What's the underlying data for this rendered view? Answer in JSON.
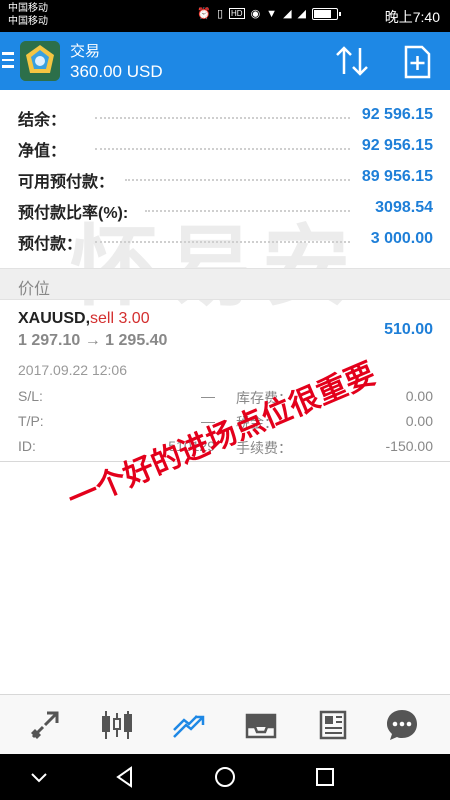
{
  "status_bar": {
    "carrier1": "中国移动",
    "carrier2": "中国移动",
    "icons": [
      "alarm-icon",
      "vibrate-icon",
      "hd-icon",
      "eye-icon",
      "wifi-icon",
      "signal-4g-icon",
      "signal-2g-icon"
    ],
    "time": "晚上7:40"
  },
  "toolbar": {
    "title": "交易",
    "subtitle": "360.00 USD",
    "color": "#1e88e5"
  },
  "summary": [
    {
      "label": "结余：",
      "value": "92 596.15"
    },
    {
      "label": "净值：",
      "value": "92 956.15"
    },
    {
      "label": "可用预付款：",
      "value": "89 956.15"
    },
    {
      "label": "预付款比率(%):",
      "value": "3098.54"
    },
    {
      "label": "预付款：",
      "value": "3 000.00"
    }
  ],
  "section": {
    "header": "价位"
  },
  "position": {
    "symbol": "XAUUSD,",
    "side": "sell 3.00",
    "prices": "1 297.10 → 1 295.40",
    "profit": "510.00",
    "time": "2017.09.22 12:06",
    "rows": [
      {
        "label1": "S/L:",
        "value1": "—",
        "label2": "库存费：",
        "value2": "0.00"
      },
      {
        "label1": "T/P:",
        "value1": "—",
        "label2": "税金：",
        "value2": "0.00"
      },
      {
        "label1": "ID:",
        "value1": "510129",
        "label2": "手续费：",
        "value2": "-150.00"
      }
    ]
  },
  "watermark": "怀易安",
  "overlay_caption": "一个好的进场点位很重要",
  "bottom_nav": {
    "items": [
      "quotes-icon",
      "chart-icon",
      "trade-icon",
      "history-icon",
      "news-icon",
      "chat-icon"
    ],
    "active": "trade-icon",
    "active_color": "#1e88e5"
  },
  "system_nav": [
    "collapse-icon",
    "back-icon",
    "home-icon",
    "recents-icon"
  ]
}
